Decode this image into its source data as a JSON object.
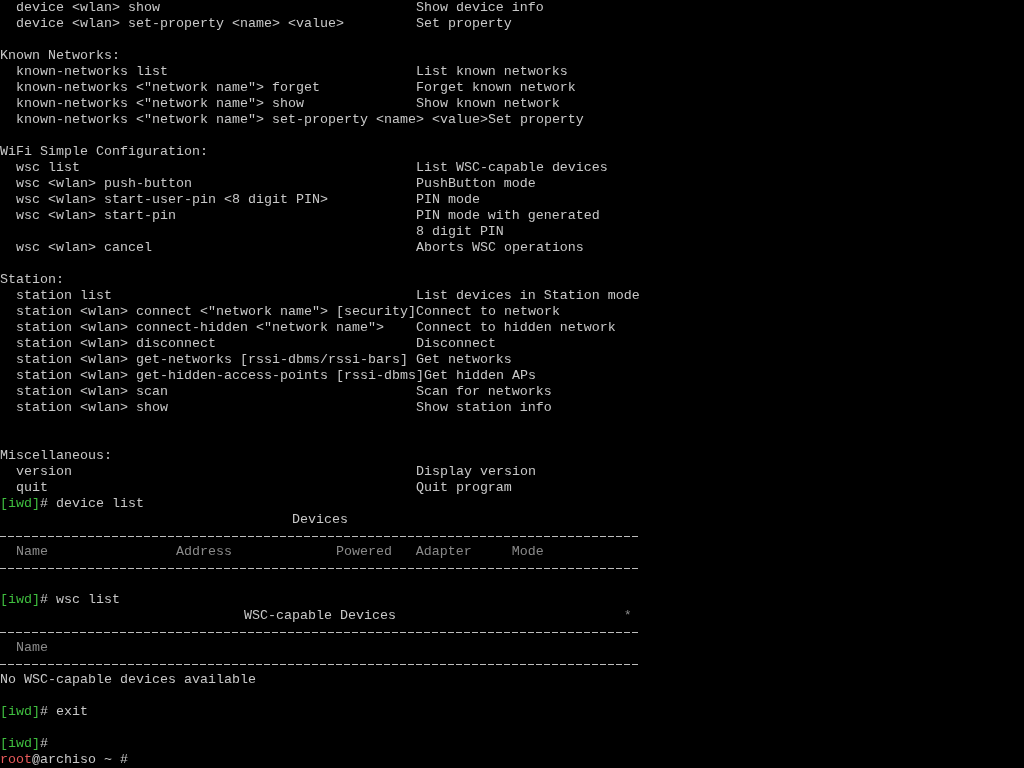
{
  "terminal": {
    "blocks": [
      {
        "kind": "help_section",
        "rows": [
          {
            "command": "device <wlan> show",
            "description": "Show device info"
          },
          {
            "command": "device <wlan> set-property <name> <value>",
            "description": "Set property"
          }
        ]
      },
      {
        "kind": "blank"
      },
      {
        "kind": "help_section",
        "heading": "Known Networks:",
        "rows": [
          {
            "command": "known-networks list",
            "description": "List known networks"
          },
          {
            "command": "known-networks <\"network name\"> forget",
            "description": "Forget known network"
          },
          {
            "command": "known-networks <\"network name\"> show",
            "description": "Show known network"
          },
          {
            "command": "known-networks <\"network name\"> set-property <name> <value>",
            "description": "Set property"
          }
        ]
      },
      {
        "kind": "blank"
      },
      {
        "kind": "help_section",
        "heading": "WiFi Simple Configuration:",
        "rows": [
          {
            "command": "wsc list",
            "description": "List WSC-capable devices"
          },
          {
            "command": "wsc <wlan> push-button",
            "description": "PushButton mode"
          },
          {
            "command": "wsc <wlan> start-user-pin <8 digit PIN>",
            "description": "PIN mode"
          },
          {
            "command": "wsc <wlan> start-pin",
            "description": "PIN mode with generated"
          },
          {
            "description": "8 digit PIN"
          },
          {
            "command": "wsc <wlan> cancel",
            "description": "Aborts WSC operations"
          }
        ]
      },
      {
        "kind": "blank"
      },
      {
        "kind": "help_section",
        "heading": "Station:",
        "rows": [
          {
            "command": "station list",
            "description": "List devices in Station mode"
          },
          {
            "command": "station <wlan> connect <\"network name\"> [security]",
            "description": "Connect to network"
          },
          {
            "command": "station <wlan> connect-hidden <\"network name\">",
            "description": "Connect to hidden network"
          },
          {
            "command": "station <wlan> disconnect",
            "description": "Disconnect"
          },
          {
            "command": "station <wlan> get-networks [rssi-dbms/rssi-bars]",
            "description": "Get networks"
          },
          {
            "command": "station <wlan> get-hidden-access-points [rssi-dbms]",
            "description": "Get hidden APs"
          },
          {
            "command": "station <wlan> scan",
            "description": "Scan for networks"
          },
          {
            "command": "station <wlan> show",
            "description": "Show station info"
          }
        ]
      },
      {
        "kind": "blank"
      },
      {
        "kind": "blank"
      },
      {
        "kind": "help_section",
        "heading": "Miscellaneous:",
        "rows": [
          {
            "command": "version",
            "description": "Display version"
          },
          {
            "command": "quit",
            "description": "Quit program"
          }
        ]
      },
      {
        "kind": "prompt",
        "prompt": "[iwd]",
        "symbol": "#",
        "command": "device list"
      },
      {
        "kind": "table",
        "title": "Devices",
        "columns": [
          "Name",
          "Address",
          "Powered",
          "Adapter",
          "Mode"
        ]
      },
      {
        "kind": "blank"
      },
      {
        "kind": "prompt",
        "prompt": "[iwd]",
        "symbol": "#",
        "command": "wsc list"
      },
      {
        "kind": "table",
        "title": "WSC-capable Devices",
        "marker": "*",
        "columns": [
          "Name"
        ]
      },
      {
        "kind": "message",
        "text": "No WSC-capable devices available"
      },
      {
        "kind": "blank"
      },
      {
        "kind": "prompt",
        "prompt": "[iwd]",
        "symbol": "#",
        "command": "exit"
      },
      {
        "kind": "blank"
      },
      {
        "kind": "prompt",
        "prompt": "[iwd]",
        "symbol": "#"
      },
      {
        "kind": "shell_prompt",
        "user": "root",
        "rest": "@archiso ~ #"
      }
    ]
  }
}
